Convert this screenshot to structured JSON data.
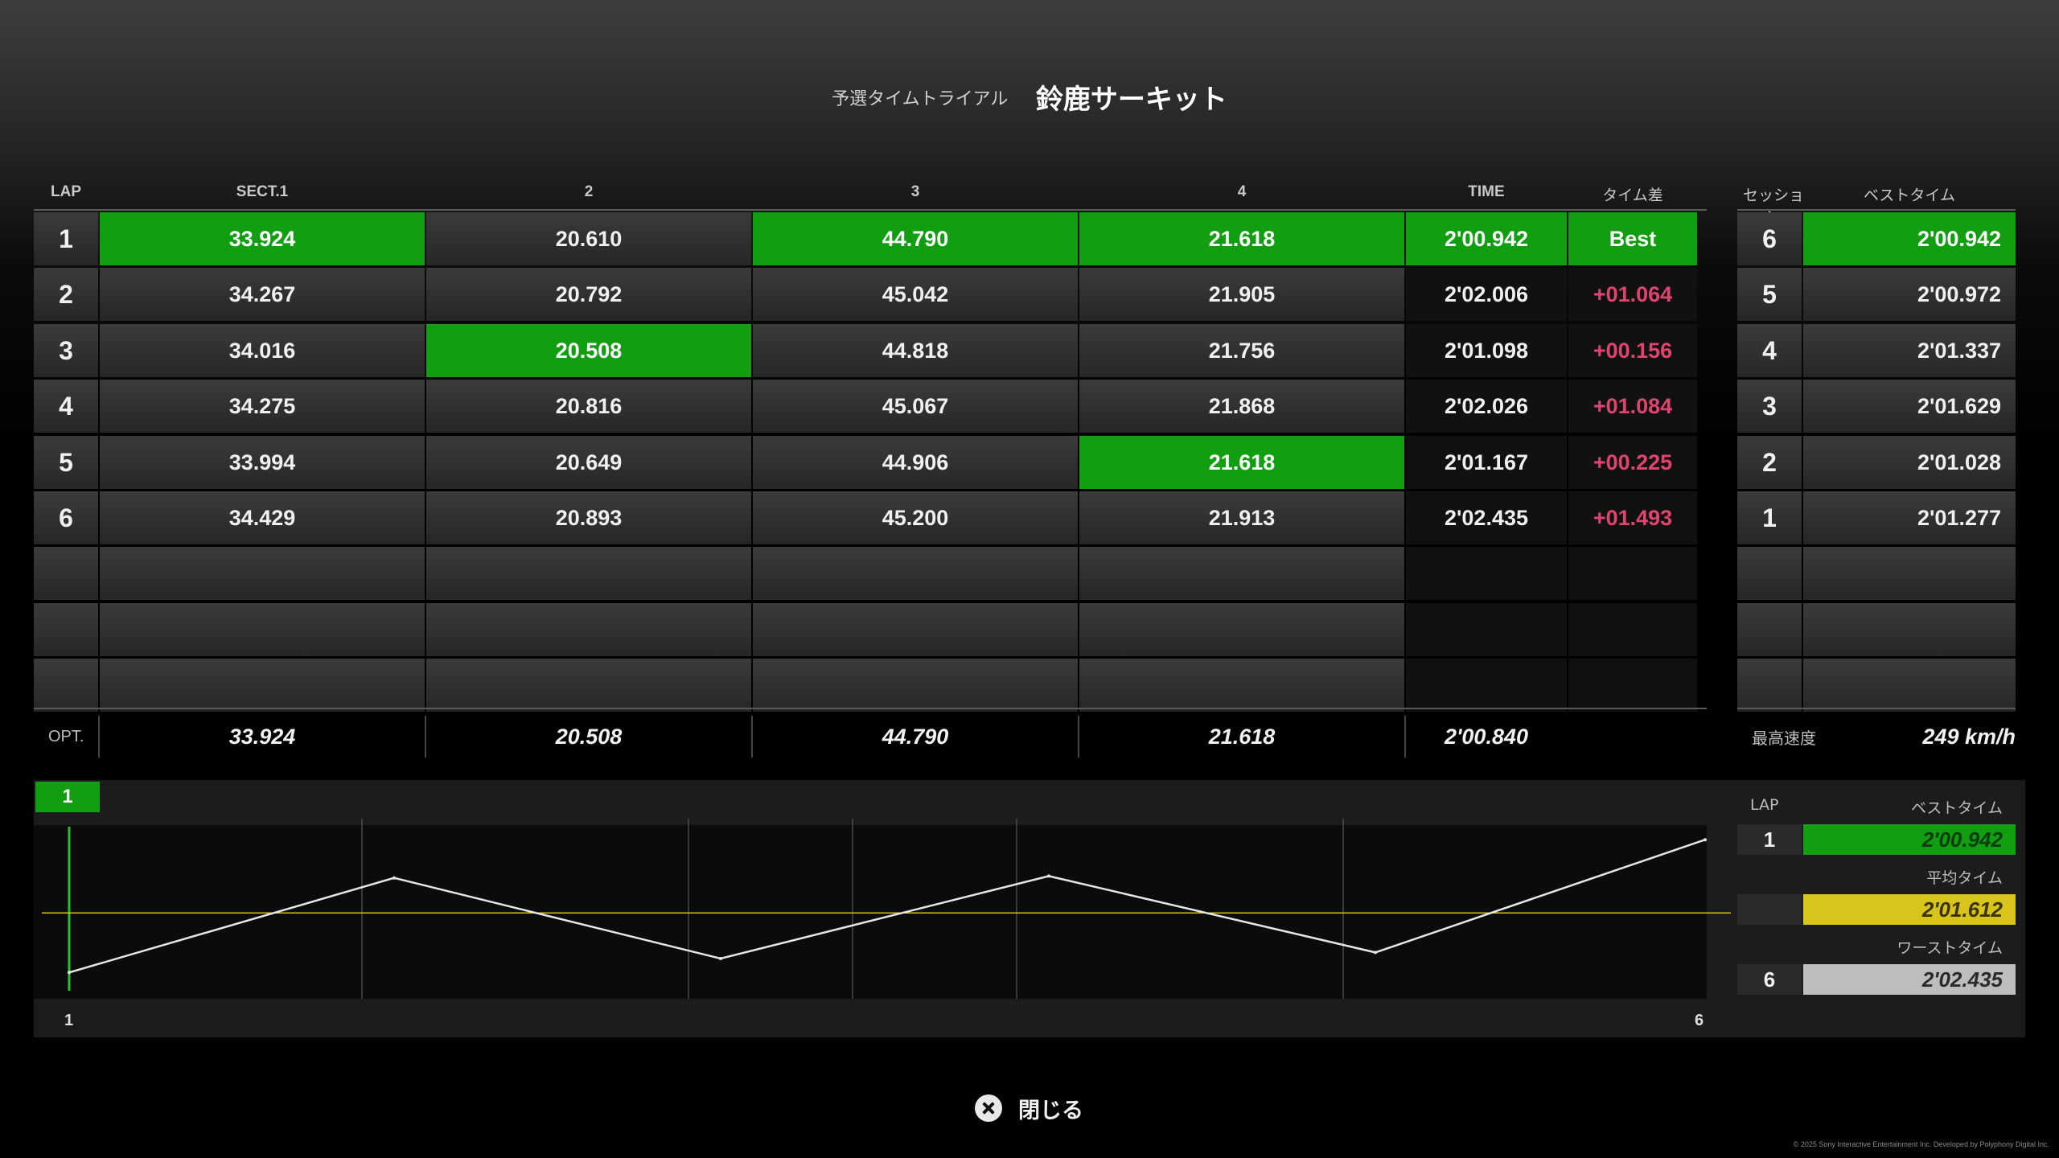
{
  "header": {
    "mode": "予選タイムトライアル",
    "track": "鈴鹿サーキット"
  },
  "lap_table": {
    "columns": [
      "LAP",
      "SECT.1",
      "2",
      "3",
      "4",
      "TIME",
      "タイム差"
    ],
    "rows": [
      {
        "lap": "1",
        "s1": "33.924",
        "s2": "20.610",
        "s3": "44.790",
        "s4": "21.618",
        "time": "2'00.942",
        "diff": "Best"
      },
      {
        "lap": "2",
        "s1": "34.267",
        "s2": "20.792",
        "s3": "45.042",
        "s4": "21.905",
        "time": "2'02.006",
        "diff": "+01.064"
      },
      {
        "lap": "3",
        "s1": "34.016",
        "s2": "20.508",
        "s3": "44.818",
        "s4": "21.756",
        "time": "2'01.098",
        "diff": "+00.156"
      },
      {
        "lap": "4",
        "s1": "34.275",
        "s2": "20.816",
        "s3": "45.067",
        "s4": "21.868",
        "time": "2'02.026",
        "diff": "+01.084"
      },
      {
        "lap": "5",
        "s1": "33.994",
        "s2": "20.649",
        "s3": "44.906",
        "s4": "21.618",
        "time": "2'01.167",
        "diff": "+00.225"
      },
      {
        "lap": "6",
        "s1": "34.429",
        "s2": "20.893",
        "s3": "45.200",
        "s4": "21.913",
        "time": "2'02.435",
        "diff": "+01.493"
      }
    ],
    "highlighted_cells": [
      {
        "row": 1,
        "column": "s1"
      },
      {
        "row": 1,
        "column": "s3"
      },
      {
        "row": 1,
        "column": "s4"
      },
      {
        "row": 1,
        "column": "time"
      },
      {
        "row": 1,
        "column": "diff"
      },
      {
        "row": 3,
        "column": "s2"
      },
      {
        "row": 5,
        "column": "s4"
      }
    ],
    "optimal": {
      "label": "OPT.",
      "s1": "33.924",
      "s2": "20.508",
      "s3": "44.790",
      "s4": "21.618",
      "time": "2'00.840"
    },
    "highlight_color": "#119e11",
    "delta_color": "#e0436e"
  },
  "session_table": {
    "columns": [
      "セッション",
      "ベストタイム"
    ],
    "rows": [
      {
        "session": "6",
        "best": "2'00.942"
      },
      {
        "session": "5",
        "best": "2'00.972"
      },
      {
        "session": "4",
        "best": "2'01.337"
      },
      {
        "session": "3",
        "best": "2'01.629"
      },
      {
        "session": "2",
        "best": "2'01.028"
      },
      {
        "session": "1",
        "best": "2'01.277"
      }
    ],
    "top_speed_label": "最高速度",
    "top_speed_value": "249 km/h"
  },
  "graph": {
    "badge": "1",
    "x_start_label": "1",
    "x_end_label": "6",
    "line_color": "#e6e6e6",
    "average_line_color": "#d8c41a"
  },
  "chart_data": {
    "type": "line",
    "x": [
      1,
      2,
      3,
      4,
      5,
      6
    ],
    "series": [
      {
        "values": [
          120.942,
          122.006,
          121.098,
          122.026,
          121.167,
          122.435
        ]
      }
    ],
    "average": 121.612,
    "ylim": [
      120.7,
      122.6
    ]
  },
  "summary": {
    "lap_header": "LAP",
    "best_header": "ベストタイム",
    "best_lap": "1",
    "best_time": "2'00.942",
    "avg_header": "平均タイム",
    "avg_time": "2'01.612",
    "worst_header": "ワーストタイム",
    "worst_lap": "6",
    "worst_time": "2'02.435",
    "best_color": "#119e11",
    "avg_color": "#d8c41a",
    "worst_color": "#bdbdbd"
  },
  "footer": {
    "close_label": "閉じる",
    "copyright": "© 2025 Sony Interactive Entertainment Inc. Developed by Polyphony Digital Inc."
  }
}
